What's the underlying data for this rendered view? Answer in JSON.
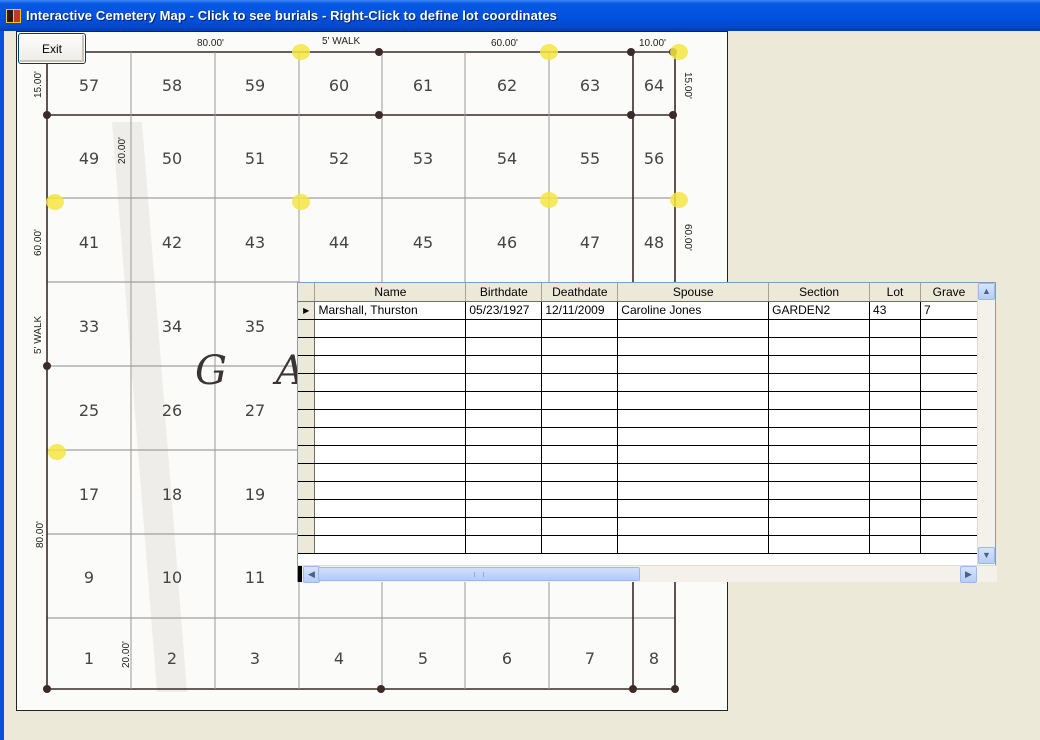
{
  "window": {
    "title": "Interactive Cemetery Map - Click to see burials - Right-Click to define lot coordinates"
  },
  "toolbar": {
    "exit_label": "Exit"
  },
  "map": {
    "lot_rows": [
      [
        "57",
        "58",
        "59",
        "60",
        "61",
        "62",
        "63",
        "64"
      ],
      [
        "49",
        "50",
        "51",
        "52",
        "53",
        "54",
        "55",
        "56"
      ],
      [
        "41",
        "42",
        "43",
        "44",
        "45",
        "46",
        "47",
        "48"
      ],
      [
        "33",
        "34",
        "35",
        "",
        "",
        "",
        "",
        ""
      ],
      [
        "25",
        "26",
        "27",
        "",
        "",
        "",
        "",
        ""
      ],
      [
        "17",
        "18",
        "19",
        "",
        "",
        "",
        "",
        ""
      ],
      [
        "9",
        "10",
        "11",
        "",
        "",
        "",
        "",
        ""
      ],
      [
        "1",
        "2",
        "3",
        "4",
        "5",
        "6",
        "7",
        "8"
      ]
    ],
    "section_letters": "G A",
    "dimensions": {
      "top_left": "80.00'",
      "top_walk": "5' WALK",
      "top_mid": "60.00'",
      "top_right": "10.00'",
      "left_top": "15.00'",
      "left_inner": "20.00'",
      "left_mid": "60.00'",
      "left_walk": "5' WALK",
      "left_bottom": "80.00'",
      "right_top": "15.00'",
      "right_mid": "60.00'",
      "bottom_inner": "20.00'"
    },
    "colors": {
      "line": "#3a2a28",
      "highlight": "#f4e542"
    }
  },
  "grid": {
    "columns": [
      "Name",
      "Birthdate",
      "Deathdate",
      "Spouse",
      "Section",
      "Lot",
      "Grave"
    ],
    "rows": [
      [
        "Marshall, Thurston",
        "05/23/1927",
        "12/11/2009",
        "Caroline Jones",
        "GARDEN2",
        "43",
        "7"
      ]
    ],
    "selected_marker": "▶"
  }
}
